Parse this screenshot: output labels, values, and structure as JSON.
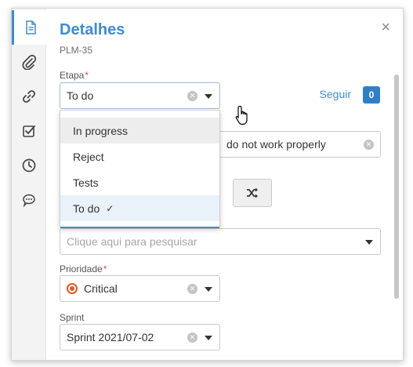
{
  "panel": {
    "title": "Detalhes",
    "subtitle": "PLM-35",
    "close_symbol": "×"
  },
  "rail": {
    "items": [
      {
        "icon": "document-icon",
        "active": true
      },
      {
        "icon": "paperclip-icon",
        "active": false
      },
      {
        "icon": "link-icon",
        "active": false
      },
      {
        "icon": "checkbox-icon",
        "active": false
      },
      {
        "icon": "clock-icon",
        "active": false
      },
      {
        "icon": "chat-icon",
        "active": false
      }
    ]
  },
  "etapa": {
    "label": "Etapa",
    "required_mark": "*",
    "value": "To do",
    "options": [
      {
        "label": "In progress",
        "hover": true,
        "selected": false
      },
      {
        "label": "Reject",
        "hover": false,
        "selected": false
      },
      {
        "label": "Tests",
        "hover": false,
        "selected": false
      },
      {
        "label": "To do",
        "hover": false,
        "selected": true
      }
    ],
    "check_symbol": "✓"
  },
  "follow": {
    "label": "Seguir",
    "count": "0"
  },
  "summary_field": {
    "value": "do not work properly"
  },
  "search_field": {
    "placeholder": "Clique aqui para pesquisar"
  },
  "prioridade": {
    "label": "Prioridade",
    "required_mark": "*",
    "value": "Critical",
    "icon": "critical-priority-icon",
    "color": "#e2591a"
  },
  "sprint": {
    "label": "Sprint",
    "value": "Sprint 2021/07-02"
  },
  "colors": {
    "accent": "#3d8bd4",
    "badge": "#2f7fc6",
    "required": "#d9534f"
  }
}
